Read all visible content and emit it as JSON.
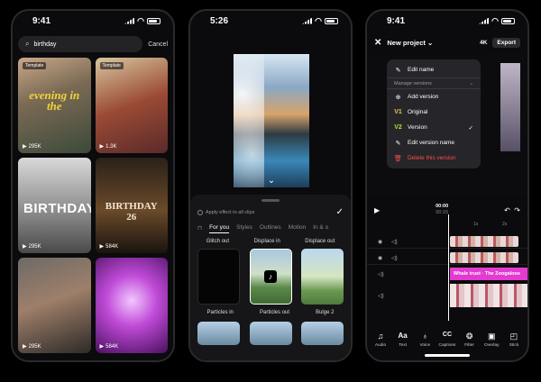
{
  "phone1": {
    "time": "9:41",
    "search_value": "birthday",
    "cancel_label": "Cancel",
    "tiles": [
      {
        "tag": "Template",
        "count": "295K",
        "text": "evening in the"
      },
      {
        "tag": "Template",
        "count": "1.3K",
        "text": ""
      },
      {
        "tag": "",
        "count": "295K",
        "text": "BIRTHDAY"
      },
      {
        "tag": "",
        "count": "584K",
        "text": "BIRTHDAY 26"
      },
      {
        "tag": "",
        "count": "295K",
        "text": ""
      },
      {
        "tag": "",
        "count": "584K",
        "text": ""
      }
    ]
  },
  "phone2": {
    "time": "5:26",
    "apply_label": "Apply effect to all clips",
    "tabs": [
      "For you",
      "Styles",
      "Outlines",
      "Motion",
      "In & o"
    ],
    "effects_top": [
      "Glitch out",
      "Displace in",
      "Displace out"
    ],
    "effects_bottom": [
      "Particles in",
      "Particles out",
      "Bulge 2"
    ]
  },
  "phone3": {
    "time": "9:41",
    "title": "New project",
    "resolution": "4K",
    "export_label": "Export",
    "menu": {
      "edit_name": "Edit name",
      "section": "Manage versions",
      "add_version": "Add version",
      "original_tag": "V1",
      "original": "Original",
      "version_tag": "V2",
      "version": "Version",
      "edit_version_name": "Edit version name",
      "delete_version": "Delete this version"
    },
    "time_current": "00:00",
    "time_total": "00:15",
    "ruler": [
      "1s",
      "2s"
    ],
    "caption": "Whale trust · The Zoogaloos",
    "tools": [
      "Audio",
      "Text",
      "Voice",
      "Captions",
      "Filter",
      "Overlay",
      "Stick"
    ]
  }
}
